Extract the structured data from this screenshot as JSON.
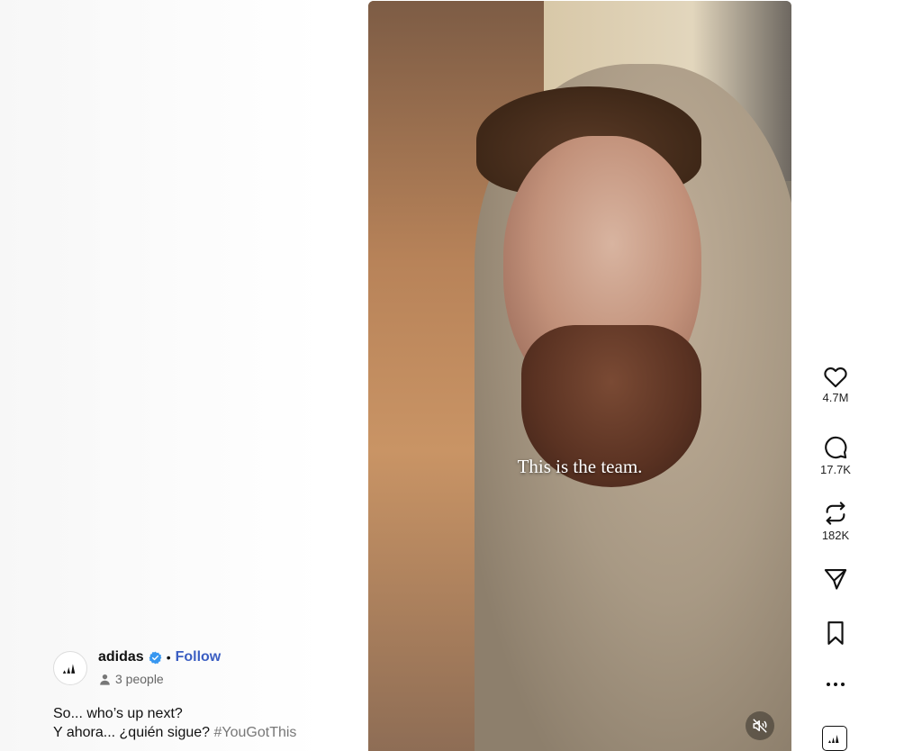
{
  "video": {
    "caption": "This is the team.",
    "mute_icon": "speaker-muted-icon"
  },
  "actions": {
    "like": {
      "icon": "heart-icon",
      "count": "4.7M"
    },
    "comment": {
      "icon": "comment-bubble-icon",
      "count": "17.7K"
    },
    "repost": {
      "icon": "repost-icon",
      "count": "182K"
    },
    "share": {
      "icon": "send-icon"
    },
    "save": {
      "icon": "bookmark-icon"
    },
    "more": {
      "icon": "more-horizontal-icon"
    },
    "audio_avatar": {
      "icon": "adidas-logo-icon"
    }
  },
  "author": {
    "name": "adidas",
    "verified_icon": "verified-badge-icon",
    "separator": "•",
    "follow_label": "Follow",
    "people_icon": "person-icon",
    "people_text": "3 people"
  },
  "post": {
    "line1": "So... who’s up next?",
    "line2_text": "Y ahora... ¿quién sigue? ",
    "hashtag": "#YouGotThis"
  },
  "colors": {
    "follow": "#3b5ec2",
    "verified": "#3897f0"
  }
}
